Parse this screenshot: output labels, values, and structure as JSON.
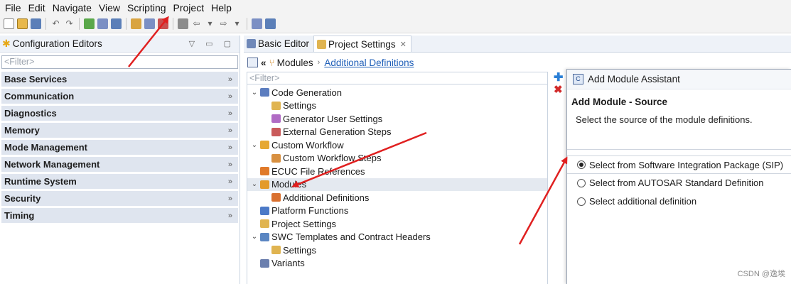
{
  "menu": [
    "File",
    "Edit",
    "Navigate",
    "View",
    "Scripting",
    "Project",
    "Help"
  ],
  "left_panel": {
    "title": "Configuration Editors",
    "filter_placeholder": "<Filter>",
    "categories": [
      "Base Services",
      "Communication",
      "Diagnostics",
      "Memory",
      "Mode Management",
      "Network Management",
      "Runtime System",
      "Security",
      "Timing"
    ]
  },
  "tabs": [
    {
      "label": "Basic Editor"
    },
    {
      "label": "Project Settings"
    }
  ],
  "breadcrumb": {
    "modules": "Modules",
    "link": "Additional Definitions"
  },
  "tree": {
    "filter_placeholder": "<Filter>",
    "nodes": [
      {
        "label": "Code Generation",
        "level": 0,
        "expanded": true,
        "icon": "code-generation-icon"
      },
      {
        "label": "Settings",
        "level": 1,
        "icon": "settings-icon"
      },
      {
        "label": "Generator User Settings",
        "level": 1,
        "icon": "generator-icon"
      },
      {
        "label": "External Generation Steps",
        "level": 1,
        "icon": "external-steps-icon"
      },
      {
        "label": "Custom Workflow",
        "level": 0,
        "expanded": true,
        "icon": "workflow-icon"
      },
      {
        "label": "Custom Workflow Steps",
        "level": 1,
        "icon": "workflow-steps-icon"
      },
      {
        "label": "ECUC File References",
        "level": 0,
        "icon": "ecuc-icon"
      },
      {
        "label": "Modules",
        "level": 0,
        "expanded": true,
        "icon": "modules-icon"
      },
      {
        "label": "Additional Definitions",
        "level": 1,
        "icon": "additional-definitions-icon"
      },
      {
        "label": "Platform Functions",
        "level": 0,
        "icon": "platform-functions-icon"
      },
      {
        "label": "Project Settings",
        "level": 0,
        "icon": "project-settings-icon"
      },
      {
        "label": "SWC Templates and Contract Headers",
        "level": 0,
        "expanded": true,
        "icon": "swc-templates-icon"
      },
      {
        "label": "Settings",
        "level": 1,
        "icon": "settings-icon"
      },
      {
        "label": "Variants",
        "level": 0,
        "icon": "variants-icon"
      }
    ]
  },
  "dialog": {
    "title": "Add Module Assistant",
    "heading": "Add Module - Source",
    "subtitle": "Select the source of the module definitions.",
    "options": [
      {
        "label": "Select from Software Integration Package (SIP)",
        "selected": true
      },
      {
        "label": "Select from AUTOSAR Standard Definition",
        "selected": false
      },
      {
        "label": "Select additional definition",
        "selected": false
      }
    ]
  },
  "watermark": "CSDN @逸埃",
  "colors": {
    "arrow": "#e02020",
    "link": "#1f5fb8"
  }
}
